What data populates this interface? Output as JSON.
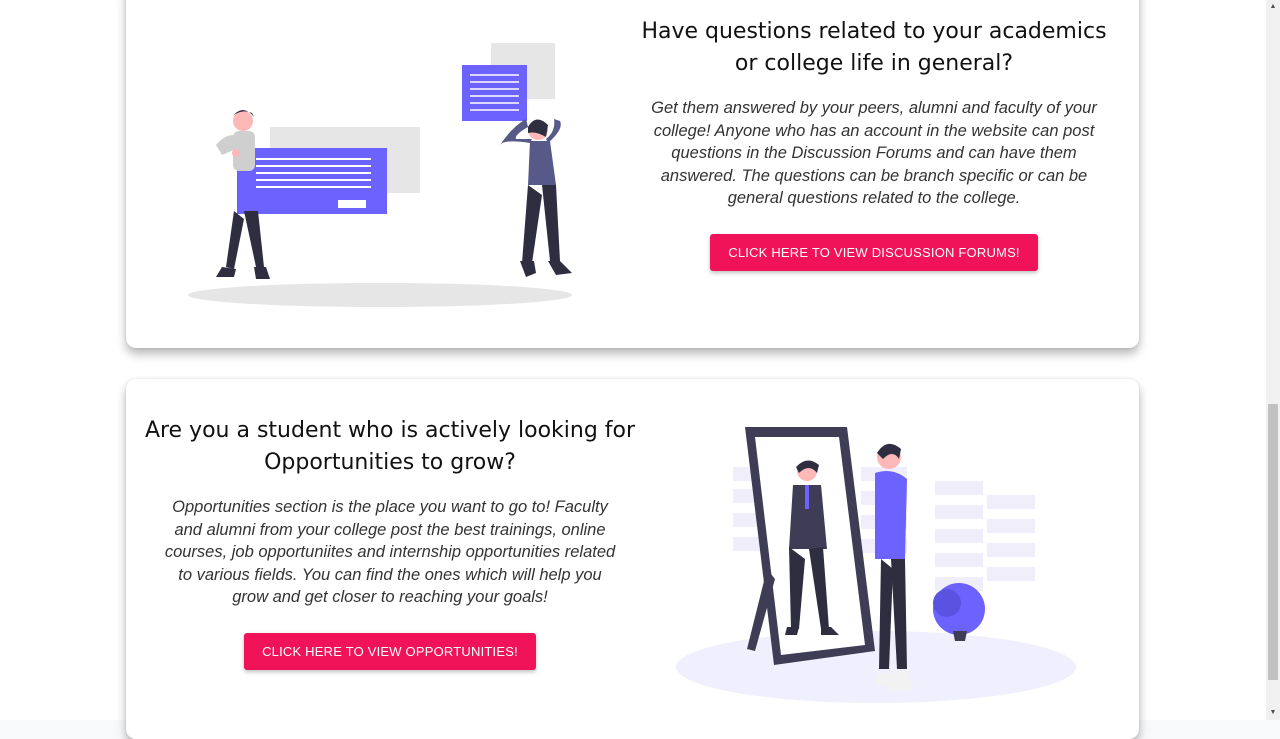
{
  "discussion": {
    "heading": "Have questions related to your academics or college life in general?",
    "description": "Get them answered by your peers, alumni and faculty of your college! Anyone who has an account in the website can post questions in the Discussion Forums and can have them answered. The questions can be branch specific or can be general questions related to the college.",
    "button_label": "CLICK HERE TO VIEW DISCUSSION FORUMS!",
    "illustration_icon": "people-discussion-illustration"
  },
  "opportunities": {
    "heading": "Are you a student who is actively looking for Opportunities to grow?",
    "description": "Opportunities section is the place you want to go to! Faculty and alumni from your college post the best trainings, online courses, job opportuniites and internship opportunities related to various fields. You can find the ones which will help you grow and get closer to reaching your goals!",
    "button_label": "CLICK HERE TO VIEW OPPORTUNITIES!",
    "illustration_icon": "man-mirror-illustration"
  },
  "colors": {
    "accent": "#f0135a",
    "illustration_purple": "#6c63ff",
    "dark": "#2f2e41"
  }
}
